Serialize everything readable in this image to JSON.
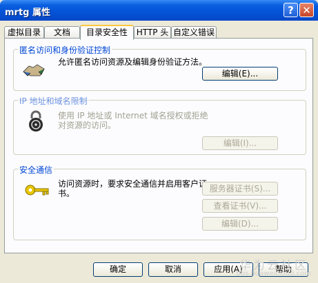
{
  "window": {
    "title": "mrtg 属性"
  },
  "title_buttons": {
    "help": "?",
    "close": "✕"
  },
  "tabs": [
    "虚拟目录",
    "文档",
    "目录安全性",
    "HTTP 头",
    "自定义错误"
  ],
  "groups": {
    "anon": {
      "title": "匿名访问和身份验证控制",
      "desc": "允许匿名访问资源及编辑身份验证方法。",
      "button": "编辑(E)..."
    },
    "ip": {
      "title": "IP 地址和域名限制",
      "desc": "使用 IP 地址或 Internet 域名授权或拒绝对资源的访问。",
      "button": "编辑(I)..."
    },
    "secure": {
      "title": "安全通信",
      "desc": "访问资源时，要求安全通信并启用客户证书。",
      "buttons": [
        "服务器证书(S)...",
        "查看证书(V)...",
        "编辑(D)..."
      ]
    }
  },
  "footer": {
    "ok": "确定",
    "cancel": "取消",
    "apply": "应用(A)",
    "help": "帮助"
  },
  "watermark": {
    "line1": "华为云社区",
    "line2": "bbs.huaweicloud.com"
  }
}
